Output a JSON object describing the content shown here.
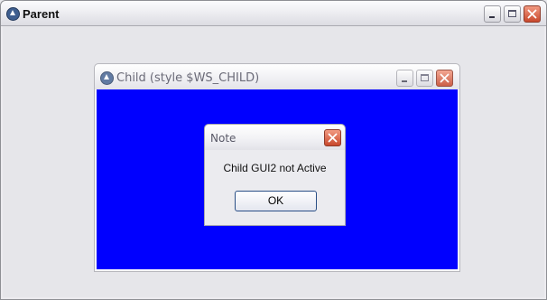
{
  "parent": {
    "title": "Parent",
    "icon": "autoit-app-icon",
    "controls": [
      "minimize-icon",
      "maximize-icon",
      "close-icon"
    ]
  },
  "child": {
    "title": "Child (style $WS_CHILD)",
    "icon": "autoit-app-icon",
    "client_color": "#0000ff",
    "controls": [
      "minimize-icon",
      "maximize-icon",
      "close-icon"
    ]
  },
  "note": {
    "title": "Note",
    "message": "Child GUI2 not Active",
    "ok_label": "OK",
    "controls": [
      "close-icon"
    ]
  }
}
